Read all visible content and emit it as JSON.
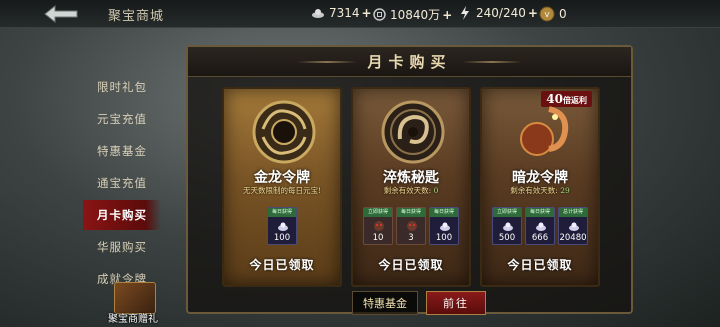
{
  "header": {
    "title": "聚宝商城",
    "resources": [
      {
        "icon": "ingot-icon",
        "value": "7314"
      },
      {
        "icon": "coin-icon",
        "value": "10840万"
      },
      {
        "icon": "energy-icon",
        "value": "240/240"
      },
      {
        "icon": "vip-icon",
        "value": "0"
      }
    ]
  },
  "sidebar": {
    "items": [
      {
        "label": "限时礼包",
        "active": false
      },
      {
        "label": "元宝充值",
        "active": false
      },
      {
        "label": "特惠基金",
        "active": false
      },
      {
        "label": "通宝充值",
        "active": false
      },
      {
        "label": "月卡购买",
        "active": true
      },
      {
        "label": "华服购买",
        "active": false
      },
      {
        "label": "成就令牌",
        "active": false
      }
    ],
    "gift_label": "聚宝商赠礼"
  },
  "panel": {
    "title": "月卡购买",
    "cards": [
      {
        "name": "金龙令牌",
        "sub": "无天数限制的每日元宝!",
        "rewards": [
          {
            "tag": "每日获得",
            "amount": "100"
          }
        ],
        "claim": "今日已领取"
      },
      {
        "name": "淬炼秘匙",
        "sub_prefix": "剩余有效天数:",
        "sub_num": "0",
        "rewards": [
          {
            "tag": "立即获得",
            "amount": "10"
          },
          {
            "tag": "每日获得",
            "amount": "3"
          },
          {
            "tag": "每日获得",
            "amount": "100"
          }
        ],
        "claim": "今日已领取"
      },
      {
        "name": "暗龙令牌",
        "badge_num": "40",
        "badge_text": "倍返利",
        "sub_prefix": "剩余有效天数:",
        "sub_num": "29",
        "rewards": [
          {
            "tag": "立即获得",
            "amount": "500"
          },
          {
            "tag": "每日获得",
            "amount": "666"
          },
          {
            "tag": "总计获得",
            "amount": "20480"
          }
        ],
        "claim": "今日已领取"
      }
    ]
  },
  "footer": {
    "fund_label": "特惠基金",
    "go_label": "前往"
  },
  "colors": {
    "active_tab": "#8a1414",
    "card_gold": "#a57a3a",
    "reward_bg": "#1f1d3a",
    "remaining_days": "#9be07a"
  }
}
